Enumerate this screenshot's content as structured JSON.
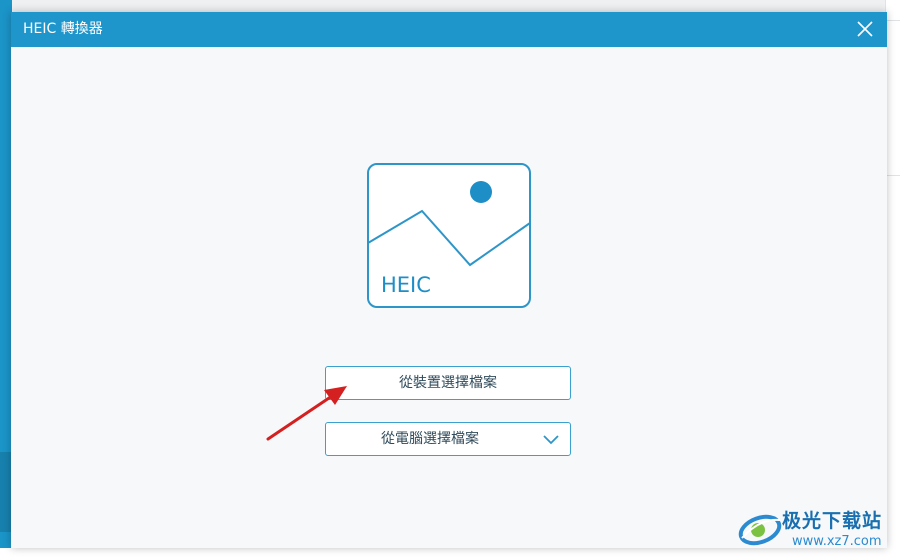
{
  "window": {
    "title": "HEIC 轉換器"
  },
  "icons": {
    "close": "close-icon",
    "placeholder": "image-placeholder-icon",
    "dropdown": "chevron-down-icon"
  },
  "placeholder": {
    "format_label": "HEIC"
  },
  "buttons": {
    "from_device": "從裝置選擇檔案",
    "from_computer": "從電腦選擇檔案"
  },
  "watermark": {
    "name": "极光下载站",
    "url": "www.xz7.com"
  },
  "colors": {
    "accent": "#1e95cb",
    "arrow": "#d42020",
    "background": "#f7f8f9"
  }
}
